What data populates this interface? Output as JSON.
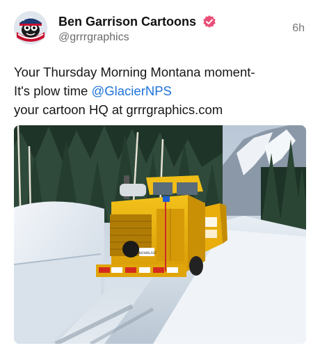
{
  "post": {
    "author": {
      "display_name": "Ben Garrison Cartoons",
      "handle": "@grrrgraphics",
      "avatar_icon": "cartoon-avatar-icon",
      "verified_icon": "verified-badge-icon",
      "verified_color": "#e94e77"
    },
    "timestamp": "6h",
    "text": {
      "line1": "Your Thursday Morning Montana moment-",
      "line2_prefix": "It's plow time ",
      "mention": "@GlacierNPS",
      "line3": "your cartoon HQ at grrrgraphics.com"
    },
    "mention_color": "#1d72d8",
    "media": {
      "kind": "photo",
      "plate_text": "SNOWBLAST"
    }
  }
}
